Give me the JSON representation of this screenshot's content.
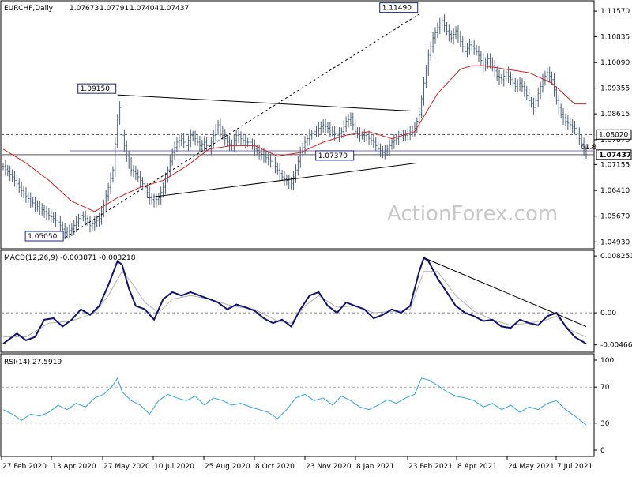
{
  "chart_data": [
    {
      "type": "line",
      "subtype": "price-bars-daily",
      "title": "EURCHF,Daily",
      "ohlc_header": [
        "1.07673",
        "1.07791",
        "1.07404",
        "1.07437"
      ],
      "y_ticks": [
        1.1157,
        1.10835,
        1.1009,
        1.09355,
        1.08615,
        1.0787,
        1.07155,
        1.0641,
        1.0567,
        1.0493
      ],
      "y_tick_labels": [
        "1.11570",
        "1.10835",
        "1.10090",
        "1.09355",
        "1.08615",
        "1.07870",
        "1.07155",
        "1.06410",
        "1.05670",
        "1.04930"
      ],
      "ylim": [
        1.048,
        1.118
      ],
      "x_tick_labels": [
        "27 Feb 2020",
        "13 Apr 2020",
        "27 May 2020",
        "10 Jul 2020",
        "25 Aug 2020",
        "8 Oct 2020",
        "23 Nov 2020",
        "8 Jan 2021",
        "23 Feb 2021",
        "8 Apr 2021",
        "24 May 2021",
        "7 Jul 2021"
      ],
      "price_path": [
        [
          0,
          1.071
        ],
        [
          4,
          1.068
        ],
        [
          8,
          1.064
        ],
        [
          12,
          1.061
        ],
        [
          16,
          1.059
        ],
        [
          20,
          1.057
        ],
        [
          24,
          1.055
        ],
        [
          27,
          1.052
        ],
        [
          30,
          1.053
        ],
        [
          32,
          1.055
        ],
        [
          34,
          1.057
        ],
        [
          36,
          1.056
        ],
        [
          38,
          1.054
        ],
        [
          40,
          1.055
        ],
        [
          42,
          1.056
        ],
        [
          44,
          1.06
        ],
        [
          46,
          1.065
        ],
        [
          48,
          1.07
        ],
        [
          50,
          1.085
        ],
        [
          51,
          1.088
        ],
        [
          52,
          1.08
        ],
        [
          54,
          1.074
        ],
        [
          56,
          1.07
        ],
        [
          58,
          1.069
        ],
        [
          60,
          1.067
        ],
        [
          62,
          1.065
        ],
        [
          64,
          1.062
        ],
        [
          66,
          1.061
        ],
        [
          68,
          1.062
        ],
        [
          70,
          1.065
        ],
        [
          72,
          1.07
        ],
        [
          74,
          1.075
        ],
        [
          76,
          1.078
        ],
        [
          78,
          1.079
        ],
        [
          80,
          1.077
        ],
        [
          82,
          1.08
        ],
        [
          84,
          1.079
        ],
        [
          86,
          1.077
        ],
        [
          88,
          1.078
        ],
        [
          90,
          1.076
        ],
        [
          92,
          1.08
        ],
        [
          94,
          1.083
        ],
        [
          96,
          1.08
        ],
        [
          98,
          1.078
        ],
        [
          100,
          1.077
        ],
        [
          102,
          1.08
        ],
        [
          104,
          1.079
        ],
        [
          106,
          1.078
        ],
        [
          108,
          1.078
        ],
        [
          110,
          1.076
        ],
        [
          112,
          1.075
        ],
        [
          114,
          1.074
        ],
        [
          116,
          1.073
        ],
        [
          118,
          1.072
        ],
        [
          120,
          1.07
        ],
        [
          122,
          1.068
        ],
        [
          124,
          1.067
        ],
        [
          126,
          1.066
        ],
        [
          128,
          1.07
        ],
        [
          130,
          1.075
        ],
        [
          132,
          1.078
        ],
        [
          134,
          1.08
        ],
        [
          136,
          1.081
        ],
        [
          138,
          1.082
        ],
        [
          140,
          1.083
        ],
        [
          142,
          1.082
        ],
        [
          144,
          1.081
        ],
        [
          146,
          1.08
        ],
        [
          148,
          1.081
        ],
        [
          150,
          1.084
        ],
        [
          152,
          1.085
        ],
        [
          154,
          1.081
        ],
        [
          156,
          1.08
        ],
        [
          158,
          1.08
        ],
        [
          160,
          1.079
        ],
        [
          162,
          1.078
        ],
        [
          164,
          1.076
        ],
        [
          166,
          1.075
        ],
        [
          168,
          1.076
        ],
        [
          170,
          1.078
        ],
        [
          172,
          1.079
        ],
        [
          174,
          1.08
        ],
        [
          176,
          1.08
        ],
        [
          178,
          1.081
        ],
        [
          180,
          1.082
        ],
        [
          182,
          1.086
        ],
        [
          184,
          1.095
        ],
        [
          186,
          1.103
        ],
        [
          188,
          1.108
        ],
        [
          190,
          1.111
        ],
        [
          192,
          1.113
        ],
        [
          194,
          1.11
        ],
        [
          196,
          1.108
        ],
        [
          198,
          1.11
        ],
        [
          200,
          1.107
        ],
        [
          202,
          1.104
        ],
        [
          204,
          1.106
        ],
        [
          206,
          1.105
        ],
        [
          208,
          1.103
        ],
        [
          210,
          1.1
        ],
        [
          212,
          1.102
        ],
        [
          214,
          1.1
        ],
        [
          216,
          1.097
        ],
        [
          218,
          1.096
        ],
        [
          220,
          1.098
        ],
        [
          222,
          1.096
        ],
        [
          224,
          1.094
        ],
        [
          226,
          1.095
        ],
        [
          228,
          1.093
        ],
        [
          230,
          1.09
        ],
        [
          232,
          1.088
        ],
        [
          234,
          1.092
        ],
        [
          236,
          1.096
        ],
        [
          238,
          1.098
        ],
        [
          240,
          1.096
        ],
        [
          242,
          1.09
        ],
        [
          244,
          1.086
        ],
        [
          246,
          1.084
        ],
        [
          248,
          1.083
        ],
        [
          250,
          1.082
        ],
        [
          252,
          1.079
        ],
        [
          254,
          1.076
        ],
        [
          255,
          1.0744
        ]
      ],
      "ma_path": [
        [
          0,
          1.076
        ],
        [
          10,
          1.072
        ],
        [
          20,
          1.067
        ],
        [
          30,
          1.061
        ],
        [
          40,
          1.058
        ],
        [
          50,
          1.062
        ],
        [
          60,
          1.065
        ],
        [
          70,
          1.067
        ],
        [
          80,
          1.071
        ],
        [
          90,
          1.076
        ],
        [
          100,
          1.077
        ],
        [
          110,
          1.077
        ],
        [
          120,
          1.074
        ],
        [
          130,
          1.075
        ],
        [
          140,
          1.078
        ],
        [
          150,
          1.08
        ],
        [
          160,
          1.081
        ],
        [
          170,
          1.079
        ],
        [
          180,
          1.081
        ],
        [
          190,
          1.092
        ],
        [
          200,
          1.099
        ],
        [
          205,
          1.1
        ],
        [
          210,
          1.1
        ],
        [
          220,
          1.099
        ],
        [
          230,
          1.098
        ],
        [
          240,
          1.095
        ],
        [
          250,
          1.089
        ]
      ],
      "trendlines": [
        {
          "from": [
            50,
            1.0916
          ],
          "to": [
            178,
            1.087
          ],
          "style": "solid"
        },
        {
          "from": [
            63,
            1.062
          ],
          "to": [
            181,
            1.072
          ],
          "style": "solid"
        },
        {
          "from": [
            27,
            1.0505
          ],
          "to": [
            182,
            1.1149
          ],
          "style": "dashed"
        }
      ],
      "horizontal_lines": [
        {
          "value": 1.0802,
          "style": "dashed",
          "label": "1.08020"
        },
        {
          "value": 1.0744,
          "style": "solid",
          "label": "1.07437"
        }
      ],
      "fib_line": {
        "value": 1.0755,
        "label": "61.8",
        "x_from": 29,
        "x_to": 255
      },
      "price_labels": [
        {
          "text": "1.11490",
          "x": 182,
          "value": 1.1149
        },
        {
          "text": "1.09150",
          "x": 50,
          "value": 1.0916
        },
        {
          "text": "1.07370",
          "x": 154,
          "value": 1.0737
        },
        {
          "text": "1.05050",
          "x": 27,
          "value": 1.0505
        }
      ],
      "watermark": "ActionForex.com"
    },
    {
      "type": "line",
      "title": "MACD(12,26,9) -0.003871 -0.003218",
      "y_ticks": [
        0.008251,
        0.0,
        -0.004661
      ],
      "y_tick_labels": [
        "0.008251",
        "0.00",
        "-0.004661"
      ],
      "ylim": [
        -0.0055,
        0.0085
      ],
      "macd_path": [
        [
          0,
          -0.0045
        ],
        [
          6,
          -0.003
        ],
        [
          10,
          -0.004
        ],
        [
          14,
          -0.0035
        ],
        [
          18,
          -0.001
        ],
        [
          22,
          -0.0008
        ],
        [
          26,
          -0.002
        ],
        [
          30,
          -0.001
        ],
        [
          34,
          0.0005
        ],
        [
          38,
          -0.0003
        ],
        [
          42,
          0.001
        ],
        [
          46,
          0.004
        ],
        [
          50,
          0.0075
        ],
        [
          52,
          0.007
        ],
        [
          55,
          0.0035
        ],
        [
          58,
          0.001
        ],
        [
          62,
          0.0005
        ],
        [
          66,
          -0.001
        ],
        [
          70,
          0.002
        ],
        [
          74,
          0.003
        ],
        [
          78,
          0.0025
        ],
        [
          82,
          0.003
        ],
        [
          86,
          0.0025
        ],
        [
          90,
          0.002
        ],
        [
          94,
          0.0015
        ],
        [
          98,
          0.0005
        ],
        [
          102,
          0.0012
        ],
        [
          106,
          0.0008
        ],
        [
          110,
          0.0003
        ],
        [
          114,
          -0.0008
        ],
        [
          118,
          -0.0015
        ],
        [
          122,
          -0.001
        ],
        [
          126,
          -0.002
        ],
        [
          130,
          0.0005
        ],
        [
          134,
          0.0025
        ],
        [
          138,
          0.003
        ],
        [
          142,
          0.001
        ],
        [
          146,
          0.0
        ],
        [
          150,
          0.0015
        ],
        [
          154,
          0.001
        ],
        [
          158,
          0.0005
        ],
        [
          162,
          -0.0008
        ],
        [
          166,
          -0.0003
        ],
        [
          170,
          0.0005
        ],
        [
          174,
          0.0
        ],
        [
          178,
          0.001
        ],
        [
          182,
          0.006
        ],
        [
          184,
          0.008
        ],
        [
          186,
          0.0075
        ],
        [
          190,
          0.005
        ],
        [
          194,
          0.003
        ],
        [
          198,
          0.001
        ],
        [
          202,
          0.0
        ],
        [
          206,
          -0.0005
        ],
        [
          210,
          -0.0012
        ],
        [
          214,
          -0.001
        ],
        [
          218,
          -0.002
        ],
        [
          222,
          -0.0022
        ],
        [
          226,
          -0.001
        ],
        [
          230,
          -0.0015
        ],
        [
          234,
          -0.0018
        ],
        [
          238,
          -0.0005
        ],
        [
          242,
          0.0
        ],
        [
          246,
          -0.002
        ],
        [
          250,
          -0.0035
        ],
        [
          255,
          -0.0045
        ]
      ],
      "signal_path": [
        [
          0,
          -0.0035
        ],
        [
          10,
          -0.0035
        ],
        [
          20,
          -0.0015
        ],
        [
          30,
          -0.0012
        ],
        [
          40,
          0.0
        ],
        [
          46,
          0.0025
        ],
        [
          52,
          0.006
        ],
        [
          56,
          0.0045
        ],
        [
          62,
          0.0015
        ],
        [
          68,
          0.0
        ],
        [
          74,
          0.002
        ],
        [
          82,
          0.0025
        ],
        [
          90,
          0.002
        ],
        [
          100,
          0.001
        ],
        [
          110,
          0.0005
        ],
        [
          120,
          -0.0012
        ],
        [
          126,
          -0.0015
        ],
        [
          132,
          0.001
        ],
        [
          138,
          0.0025
        ],
        [
          146,
          0.0008
        ],
        [
          154,
          0.001
        ],
        [
          162,
          0.0
        ],
        [
          170,
          0.0002
        ],
        [
          178,
          0.0005
        ],
        [
          184,
          0.006
        ],
        [
          190,
          0.006
        ],
        [
          198,
          0.0025
        ],
        [
          206,
          0.0002
        ],
        [
          214,
          -0.001
        ],
        [
          222,
          -0.0018
        ],
        [
          230,
          -0.0015
        ],
        [
          238,
          -0.001
        ],
        [
          242,
          -0.0005
        ],
        [
          248,
          -0.0025
        ],
        [
          255,
          -0.0035
        ]
      ],
      "trendlines": [
        {
          "from": [
            184,
            0.008
          ],
          "to": [
            255,
            -0.002
          ],
          "style": "solid"
        }
      ]
    },
    {
      "type": "line",
      "title": "RSI(14) 27.5919",
      "y_ticks": [
        100,
        70,
        30,
        0
      ],
      "y_tick_labels": [
        "100",
        "70",
        "30",
        "0"
      ],
      "ylim": [
        0,
        100
      ],
      "rsi_path": [
        [
          0,
          45
        ],
        [
          4,
          40
        ],
        [
          8,
          33
        ],
        [
          12,
          40
        ],
        [
          16,
          38
        ],
        [
          20,
          42
        ],
        [
          24,
          50
        ],
        [
          28,
          45
        ],
        [
          32,
          52
        ],
        [
          36,
          48
        ],
        [
          40,
          58
        ],
        [
          44,
          62
        ],
        [
          48,
          72
        ],
        [
          50,
          80
        ],
        [
          52,
          65
        ],
        [
          56,
          55
        ],
        [
          60,
          50
        ],
        [
          64,
          40
        ],
        [
          68,
          55
        ],
        [
          72,
          62
        ],
        [
          76,
          58
        ],
        [
          80,
          55
        ],
        [
          84,
          60
        ],
        [
          88,
          50
        ],
        [
          92,
          58
        ],
        [
          96,
          55
        ],
        [
          100,
          50
        ],
        [
          104,
          52
        ],
        [
          108,
          48
        ],
        [
          112,
          45
        ],
        [
          116,
          42
        ],
        [
          120,
          35
        ],
        [
          124,
          45
        ],
        [
          128,
          58
        ],
        [
          132,
          62
        ],
        [
          136,
          55
        ],
        [
          140,
          58
        ],
        [
          144,
          50
        ],
        [
          148,
          60
        ],
        [
          152,
          55
        ],
        [
          156,
          48
        ],
        [
          160,
          45
        ],
        [
          164,
          50
        ],
        [
          168,
          56
        ],
        [
          172,
          52
        ],
        [
          176,
          58
        ],
        [
          180,
          62
        ],
        [
          183,
          80
        ],
        [
          186,
          78
        ],
        [
          190,
          72
        ],
        [
          194,
          65
        ],
        [
          198,
          60
        ],
        [
          202,
          58
        ],
        [
          206,
          55
        ],
        [
          210,
          48
        ],
        [
          214,
          52
        ],
        [
          218,
          45
        ],
        [
          222,
          50
        ],
        [
          226,
          42
        ],
        [
          230,
          48
        ],
        [
          234,
          45
        ],
        [
          238,
          52
        ],
        [
          242,
          55
        ],
        [
          246,
          45
        ],
        [
          250,
          38
        ],
        [
          255,
          28
        ]
      ]
    }
  ]
}
